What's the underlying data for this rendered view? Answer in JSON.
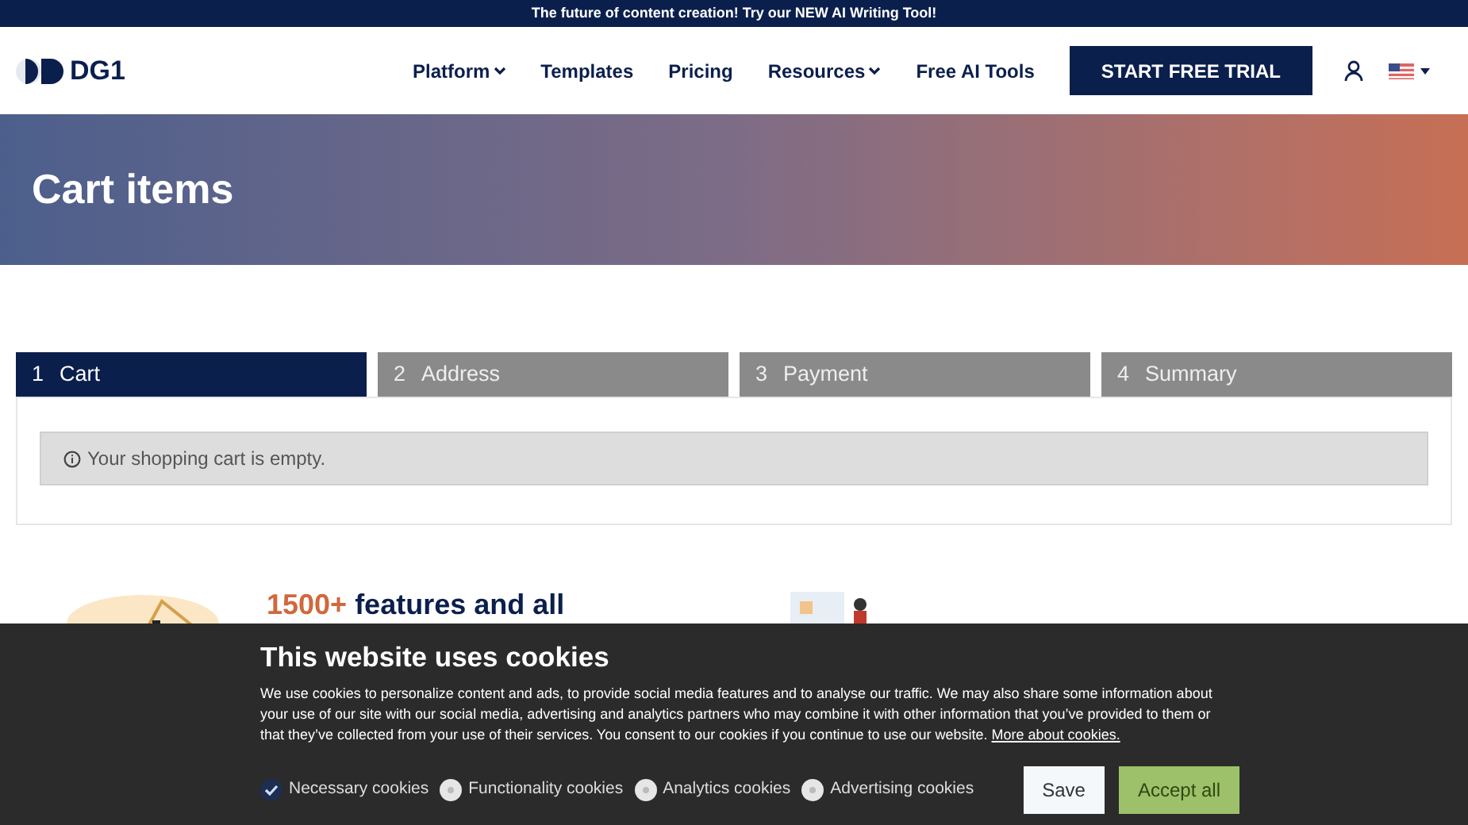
{
  "announcement": "The future of content creation! Try our NEW AI Writing Tool!",
  "header": {
    "logo": "DG1",
    "nav": [
      {
        "label": "Platform",
        "has_menu": true
      },
      {
        "label": "Templates",
        "has_menu": false
      },
      {
        "label": "Pricing",
        "has_menu": false
      },
      {
        "label": "Resources",
        "has_menu": true
      },
      {
        "label": "Free AI Tools",
        "has_menu": false
      }
    ],
    "cta": "START FREE TRIAL"
  },
  "hero": {
    "title": "Cart items"
  },
  "steps": [
    {
      "number": "1",
      "label": "Cart",
      "selected": true
    },
    {
      "number": "2",
      "label": "Address",
      "selected": false
    },
    {
      "number": "3",
      "label": "Payment",
      "selected": false
    },
    {
      "number": "4",
      "label": "Summary",
      "selected": false
    }
  ],
  "cart_message": "Your shopping cart is empty.",
  "features": [
    {
      "kind": "chart",
      "parts": [
        {
          "text": "1500+",
          "highlight": true
        },
        {
          "text": " features and all",
          "highlight": false
        }
      ]
    },
    {
      "kind": "launch"
    }
  ],
  "cookie_banner": {
    "title": "This website uses cookies",
    "text": "We use cookies to personalize content and ads, to provide social media features and to analyse our traffic. We may also share some information about your use of our site with our social media, advertising and analytics partners who may combine it with other information that you’ve provided to them or that they’ve collected from your use of their services. You consent to our cookies if you continue to use our website.",
    "link": "More about cookies.",
    "options": [
      {
        "label": "Necessary cookies",
        "checked": true
      },
      {
        "label": "Functionality cookies",
        "checked": false
      },
      {
        "label": "Analytics cookies",
        "checked": false
      },
      {
        "label": "Advertising cookies",
        "checked": false
      }
    ],
    "buttons": [
      {
        "label": "Save",
        "kind": "secondary"
      },
      {
        "label": "Accept all",
        "kind": "primary"
      }
    ]
  }
}
